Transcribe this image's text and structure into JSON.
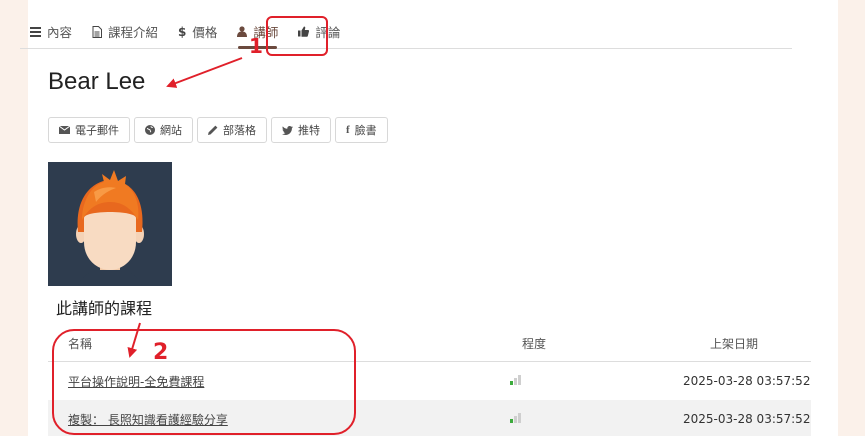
{
  "tabs": [
    {
      "label": "內容",
      "icon": "list-icon"
    },
    {
      "label": "課程介紹",
      "icon": "document-icon"
    },
    {
      "label": "價格",
      "icon": "dollar-icon"
    },
    {
      "label": "講師",
      "icon": "user-icon",
      "active": true
    },
    {
      "label": "評論",
      "icon": "thumbs-up-icon"
    }
  ],
  "instructor": {
    "name": "Bear Lee",
    "social": [
      {
        "label": "電子郵件",
        "icon": "envelope-icon"
      },
      {
        "label": "網站",
        "icon": "globe-icon"
      },
      {
        "label": "部落格",
        "icon": "pencil-icon"
      },
      {
        "label": "推特",
        "icon": "twitter-icon"
      },
      {
        "label": "臉書",
        "icon": "facebook-icon"
      }
    ]
  },
  "courses": {
    "title": "此講師的課程",
    "columns": [
      "名稱",
      "程度",
      "上架日期"
    ],
    "rows": [
      {
        "name": "平台操作說明-全免費課程",
        "level": 1,
        "date": "2025-03-28 03:57:52"
      },
      {
        "name": "複製： 長照知識看護經驗分享",
        "level": 1,
        "date": "2025-03-28 03:57:52"
      }
    ]
  },
  "annotations": {
    "label1": "1",
    "label2": "2",
    "color": "#e0202a"
  },
  "colors": {
    "accent": "#6b4a3e",
    "background": "#fbf1ea",
    "level_on": "#3cab3c",
    "level_off": "#cfcfcf"
  }
}
